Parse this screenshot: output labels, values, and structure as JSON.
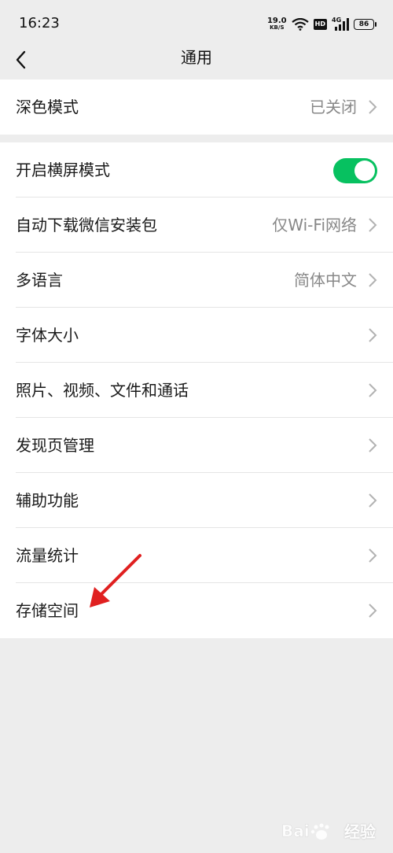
{
  "status_bar": {
    "time": "16:23",
    "net_speed_value": "19.0",
    "net_speed_unit": "KB/S",
    "hd_badge": "HD",
    "network_type": "4G",
    "battery": "86"
  },
  "nav": {
    "title": "通用"
  },
  "group1": {
    "items": [
      {
        "label": "深色模式",
        "value": "已关闭"
      }
    ]
  },
  "group2": {
    "items": [
      {
        "label": "开启横屏模式",
        "toggle_on": true
      },
      {
        "label": "自动下载微信安装包",
        "value": "仅Wi-Fi网络"
      },
      {
        "label": "多语言",
        "value": "简体中文"
      },
      {
        "label": "字体大小"
      },
      {
        "label": "照片、视频、文件和通话"
      },
      {
        "label": "发现页管理"
      },
      {
        "label": "辅助功能"
      },
      {
        "label": "流量统计"
      },
      {
        "label": "存储空间"
      }
    ]
  },
  "colors": {
    "accent_green": "#07c160",
    "annotation_arrow": "#e02020"
  },
  "watermark": {
    "text": "经验"
  }
}
